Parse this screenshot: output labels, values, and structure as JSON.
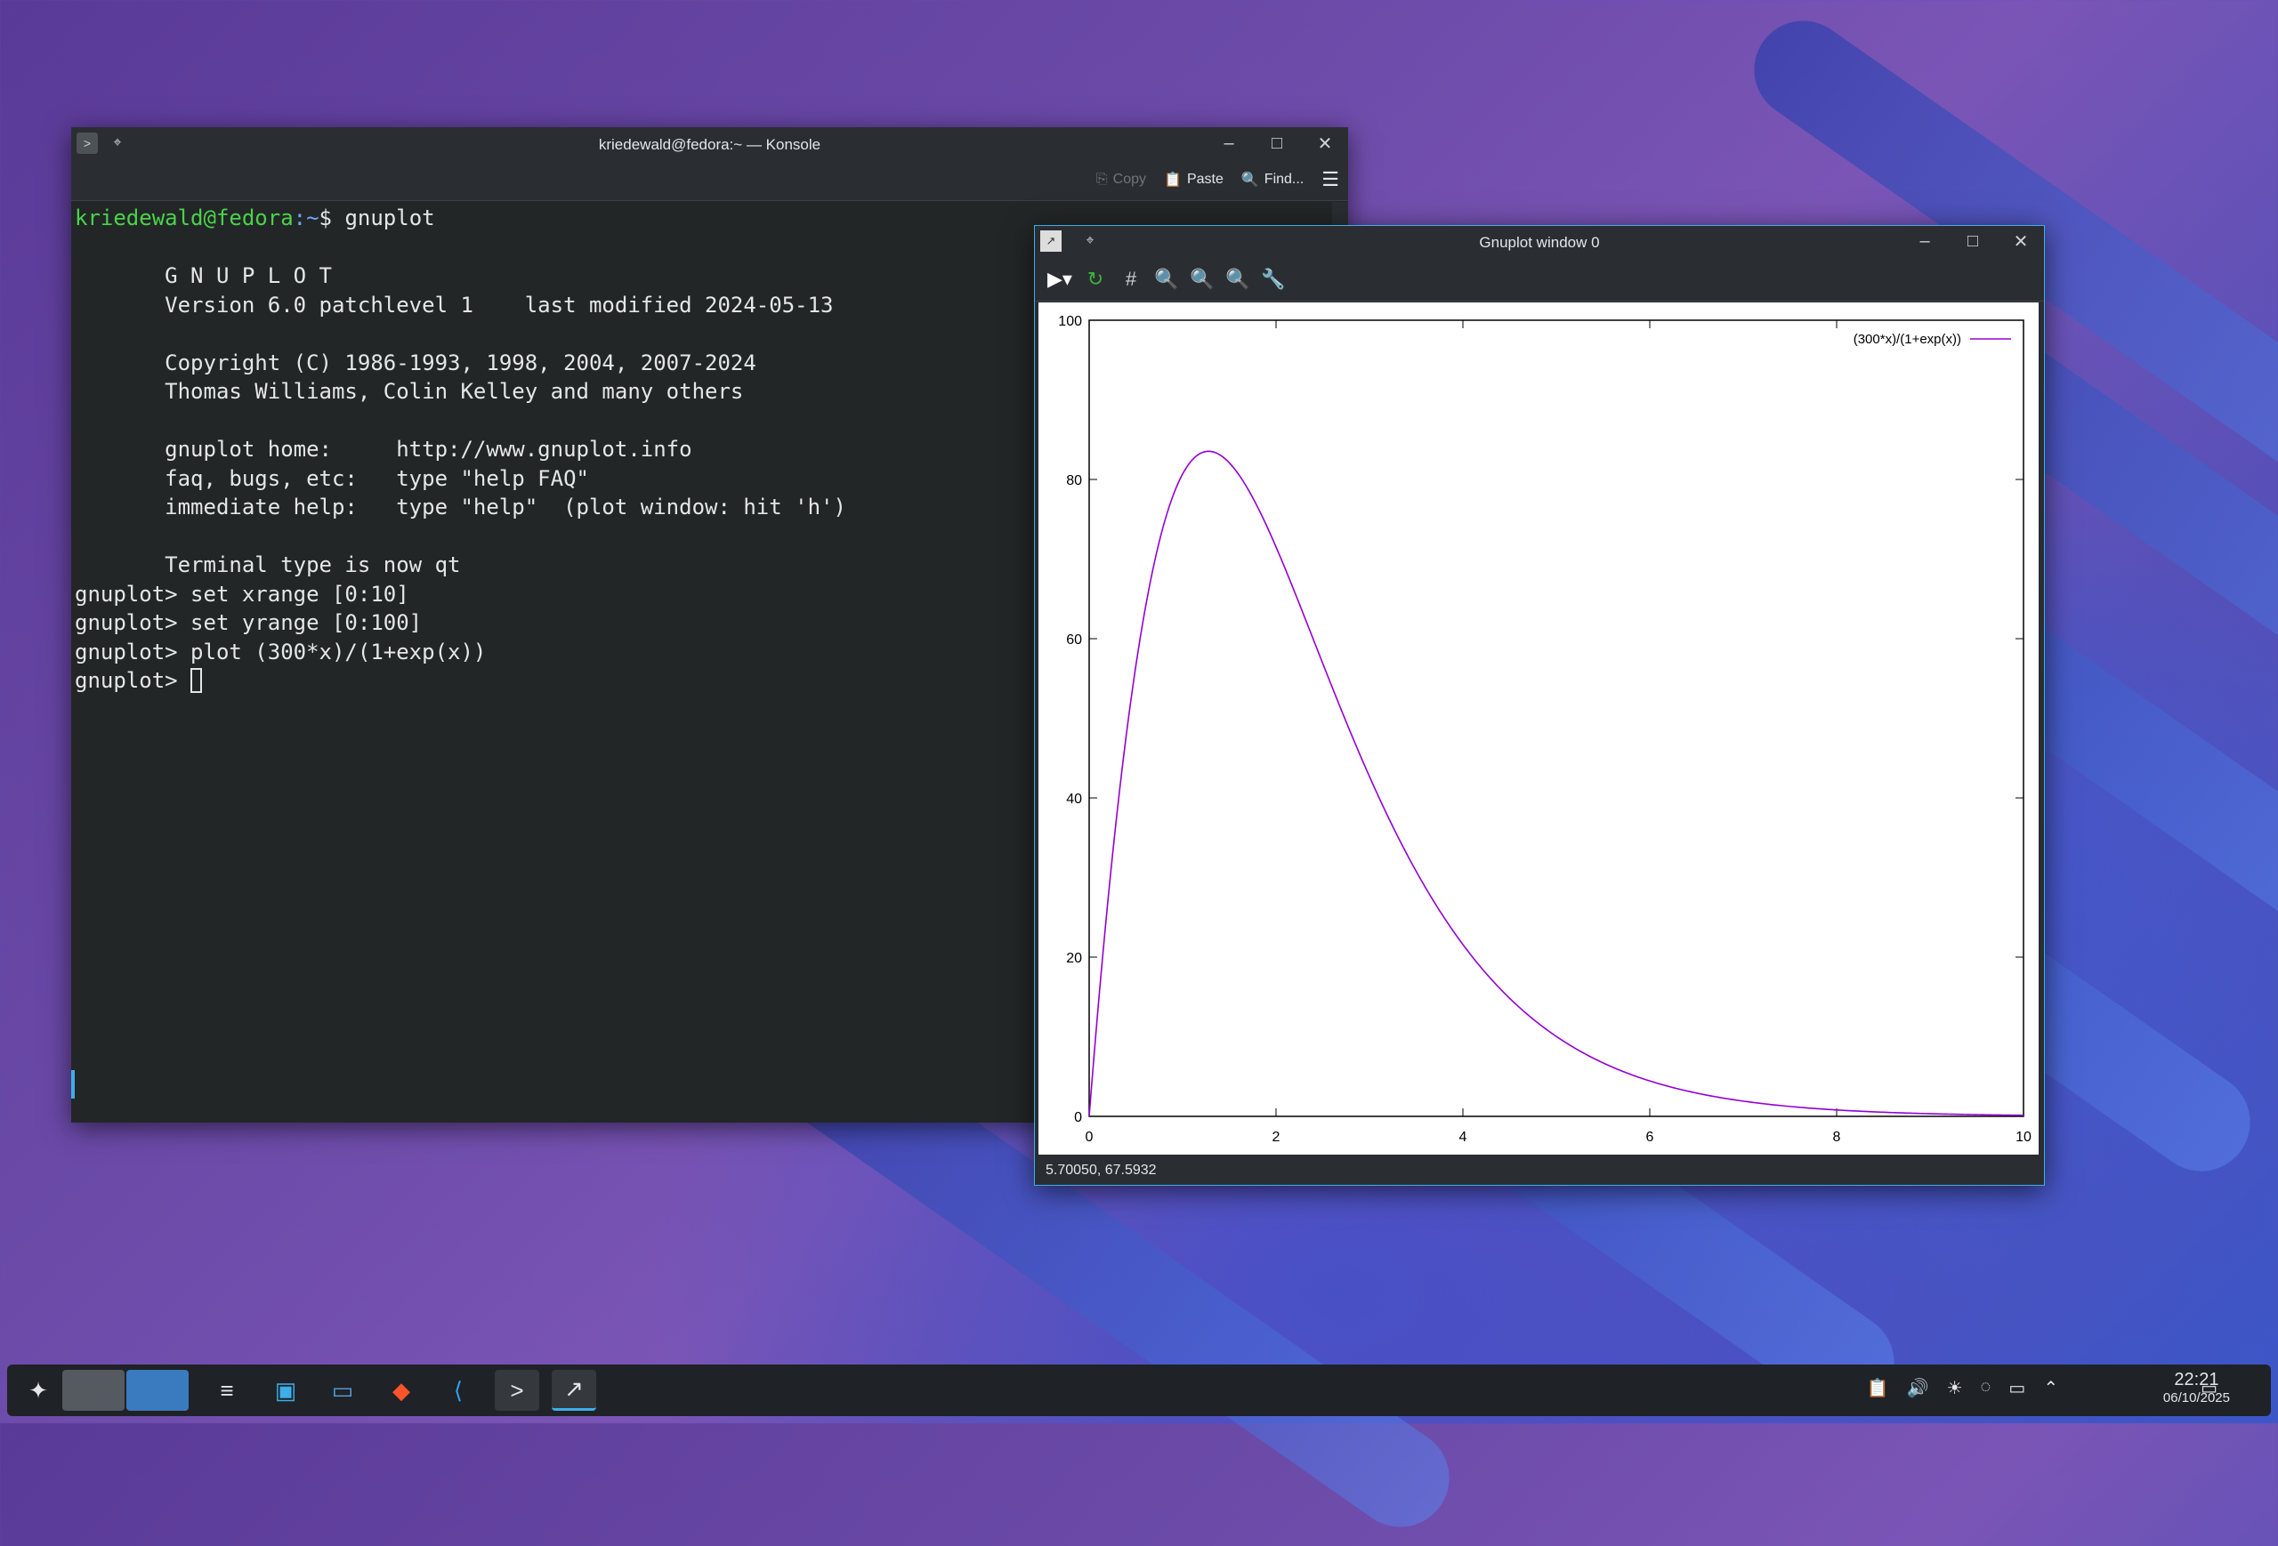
{
  "konsole": {
    "title": "kriedewald@fedora:~ — Konsole",
    "toolbar": {
      "copy": "Copy",
      "paste": "Paste",
      "find": "Find..."
    },
    "prompt_user": "kriedewald@fedora",
    "prompt_path": ":~",
    "prompt_symbol": "$ gnuplot",
    "lines": [
      "",
      "       G N U P L O T",
      "       Version 6.0 patchlevel 1    last modified 2024-05-13",
      "",
      "       Copyright (C) 1986-1993, 1998, 2004, 2007-2024",
      "       Thomas Williams, Colin Kelley and many others",
      "",
      "       gnuplot home:     http://www.gnuplot.info",
      "       faq, bugs, etc:   type \"help FAQ\"",
      "       immediate help:   type \"help\"  (plot window: hit 'h')",
      "",
      "       Terminal type is now qt",
      "gnuplot> set xrange [0:10]",
      "gnuplot> set yrange [0:100]",
      "gnuplot> plot (300*x)/(1+exp(x))"
    ],
    "last_prompt": "gnuplot> "
  },
  "gnuplot": {
    "title": "Gnuplot window 0",
    "status": "5.70050,  67.5932"
  },
  "chart_data": {
    "type": "line",
    "title": "",
    "xlabel": "",
    "ylabel": "",
    "xlim": [
      0,
      10
    ],
    "ylim": [
      0,
      100
    ],
    "xticks": [
      0,
      2,
      4,
      6,
      8,
      10
    ],
    "yticks": [
      0,
      20,
      40,
      60,
      80,
      100
    ],
    "legend": "top-right",
    "grid": false,
    "series": [
      {
        "name": "(300*x)/(1+exp(x))",
        "color": "#9400d3",
        "x": [
          0,
          0.25,
          0.5,
          0.75,
          1,
          1.25,
          1.5,
          1.75,
          2,
          2.5,
          3,
          3.5,
          4,
          4.5,
          5,
          6,
          7,
          8,
          9,
          10
        ],
        "y": [
          0,
          42.2,
          56.1,
          79.7,
          80.7,
          83.3,
          82.3,
          78.8,
          71.5,
          56.2,
          42.8,
          30.5,
          21.5,
          14.9,
          10.0,
          4.5,
          1.9,
          0.8,
          0.3,
          0.1
        ]
      }
    ]
  },
  "taskbar": {
    "time": "22:21",
    "date": "06/10/2025"
  }
}
